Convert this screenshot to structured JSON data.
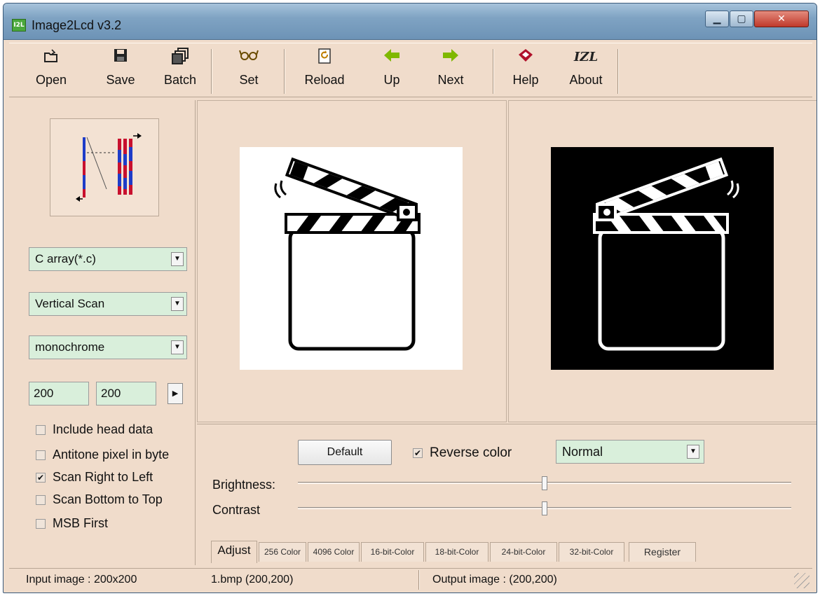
{
  "window": {
    "title": "Image2Lcd v3.2",
    "app_icon_text": "I2L"
  },
  "toolbar": {
    "buttons": [
      {
        "label": "Open",
        "icon": "open-folder-icon",
        "glyph": "📂"
      },
      {
        "label": "Save",
        "icon": "save-disk-icon",
        "glyph": "🖫"
      },
      {
        "label": "Batch",
        "icon": "batch-icon",
        "glyph": "❐"
      },
      {
        "label": "Set",
        "icon": "glasses-icon",
        "glyph": "ꝏ"
      },
      {
        "label": "Reload",
        "icon": "reload-icon",
        "glyph": "⟳"
      },
      {
        "label": "Up",
        "icon": "arrow-left-icon",
        "glyph": "⬅"
      },
      {
        "label": "Next",
        "icon": "arrow-right-icon",
        "glyph": "➡"
      },
      {
        "label": "Help",
        "icon": "help-book-icon",
        "glyph": "◆"
      },
      {
        "label": "About",
        "icon": "about-izl-icon",
        "glyph": "IZL"
      }
    ],
    "accent_arrow_color": "#7fb800"
  },
  "left_panel": {
    "output_format": "C array(*.c)",
    "scan_mode": "Vertical Scan",
    "color_depth": "monochrome",
    "max_width": "200",
    "max_height": "200",
    "options": [
      {
        "label": "Include head data",
        "checked": false
      },
      {
        "label": "Antitone pixel in byte",
        "checked": false
      },
      {
        "label": "Scan Right to Left",
        "checked": true
      },
      {
        "label": "Scan Bottom to Top",
        "checked": false
      },
      {
        "label": "MSB First",
        "checked": false
      }
    ]
  },
  "adjust": {
    "default_label": "Default",
    "reverse_color_label": "Reverse color",
    "reverse_color_checked": true,
    "mode": "Normal",
    "brightness_label": "Brightness:",
    "contrast_label": "Contrast",
    "brightness_level": 0.5,
    "contrast_level": 0.5
  },
  "tabs": [
    {
      "label": "Adjust",
      "active": true
    },
    {
      "label": "256 Color",
      "active": false
    },
    {
      "label": "4096 Color",
      "active": false
    },
    {
      "label": "16-bit-Color",
      "active": false
    },
    {
      "label": "18-bit-Color",
      "active": false
    },
    {
      "label": "24-bit-Color",
      "active": false
    },
    {
      "label": "32-bit-Color",
      "active": false
    },
    {
      "label": "Register",
      "active": false
    }
  ],
  "status": {
    "input_image": "Input image : 200x200",
    "file": "1.bmp (200,200)",
    "output_image": "Output image : (200,200)"
  },
  "colors": {
    "panel_bg": "#f0dccb",
    "field_bg": "#d9efdb"
  }
}
